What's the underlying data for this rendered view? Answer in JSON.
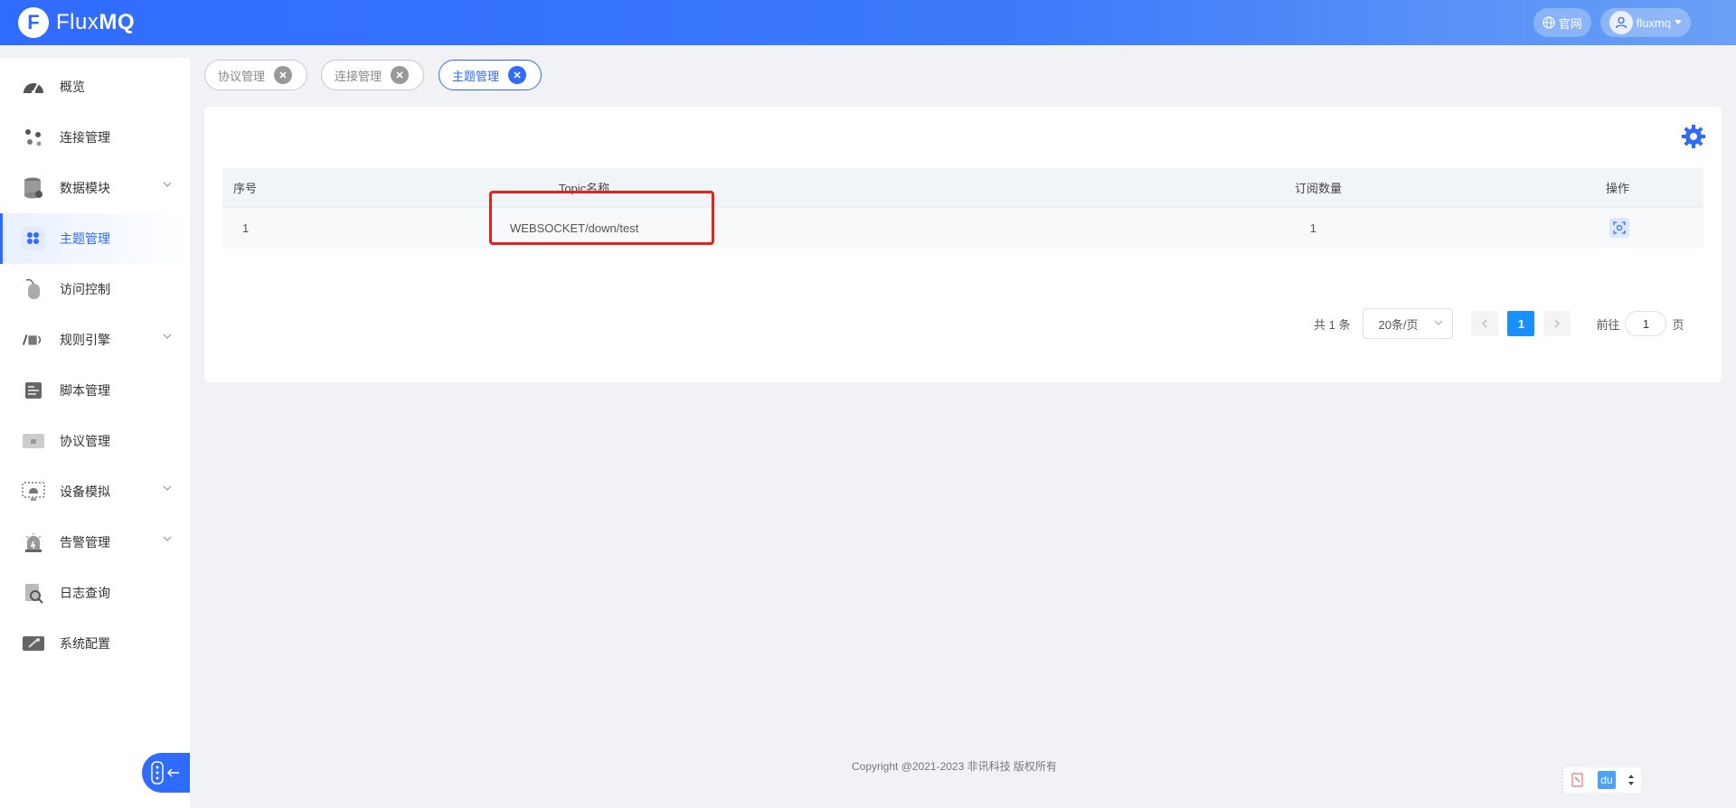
{
  "header": {
    "logo_letter": "F",
    "logo_text_a": "Flux",
    "logo_text_b": "MQ",
    "official_site": "官网",
    "username": "fluxmq"
  },
  "sidebar": {
    "items": [
      {
        "label": "概览",
        "icon": "gauge-icon"
      },
      {
        "label": "连接管理",
        "icon": "nodes-icon"
      },
      {
        "label": "数据模块",
        "icon": "database-icon",
        "expandable": true
      },
      {
        "label": "主题管理",
        "icon": "topics-icon",
        "active": true
      },
      {
        "label": "访问控制",
        "icon": "mouse-icon"
      },
      {
        "label": "规则引擎",
        "icon": "rules-icon",
        "expandable": true
      },
      {
        "label": "脚本管理",
        "icon": "script-icon"
      },
      {
        "label": "协议管理",
        "icon": "protocol-icon"
      },
      {
        "label": "设备模拟",
        "icon": "device-icon",
        "expandable": true
      },
      {
        "label": "告警管理",
        "icon": "alarm-icon",
        "expandable": true
      },
      {
        "label": "日志查询",
        "icon": "log-search-icon"
      },
      {
        "label": "系统配置",
        "icon": "settings-icon"
      }
    ]
  },
  "tabs": [
    {
      "label": "协议管理"
    },
    {
      "label": "连接管理"
    },
    {
      "label": "主题管理",
      "active": true
    }
  ],
  "table": {
    "columns": [
      "序号",
      "Topic名称",
      "订阅数量",
      "操作"
    ],
    "rows": [
      {
        "index": "1",
        "topic": "WEBSOCKET/down/test",
        "count": "1"
      }
    ]
  },
  "pagination": {
    "total": "共 1 条",
    "page_size": "20条/页",
    "current_page": "1",
    "goto_prefix": "前往",
    "goto_value": "1",
    "goto_suffix": "页"
  },
  "footer": {
    "copyright": "Copyright @2021-2023 非讯科技 版权所有"
  },
  "widget": {
    "du_label": "du"
  },
  "colors": {
    "primary": "#2f6bff",
    "highlight": "#e5231c",
    "page_active": "#1890ff"
  }
}
